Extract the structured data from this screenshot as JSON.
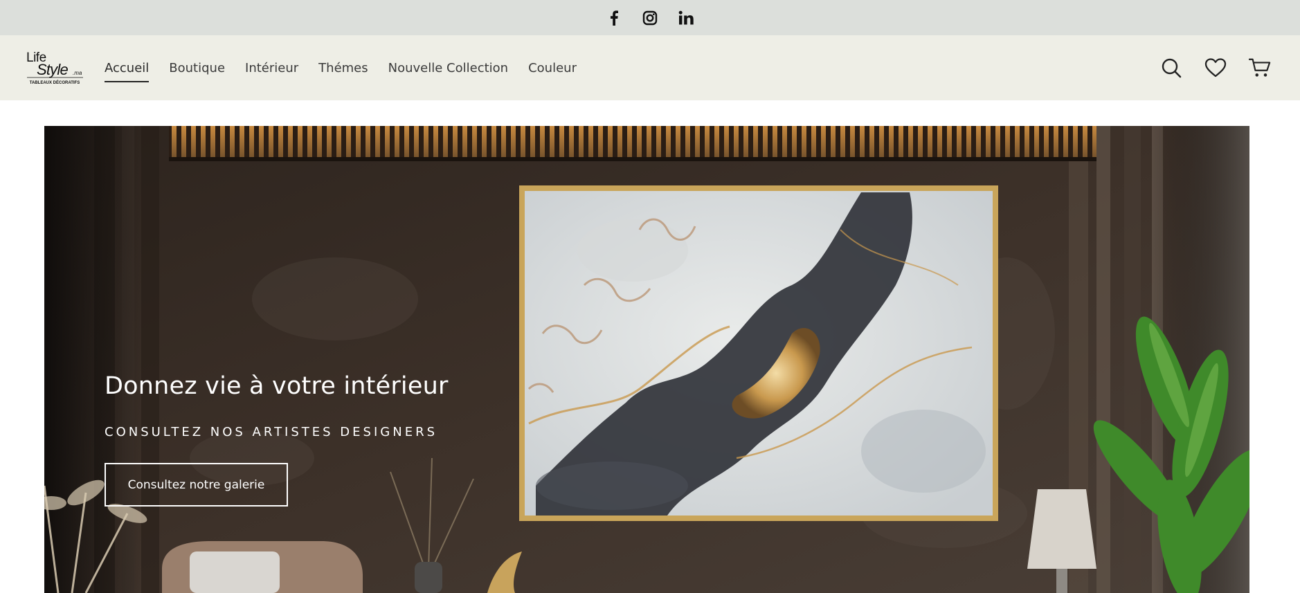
{
  "social": [
    {
      "icon": "facebook-icon"
    },
    {
      "icon": "instagram-icon"
    },
    {
      "icon": "linkedin-icon"
    }
  ],
  "logo": {
    "line1": "Life",
    "line2": "Style",
    "suffix": ".ma",
    "tagline": "TABLEAUX DÉCORATIFS"
  },
  "nav": {
    "items": [
      {
        "label": "Accueil",
        "active": true
      },
      {
        "label": "Boutique"
      },
      {
        "label": "Intérieur"
      },
      {
        "label": "Thémes"
      },
      {
        "label": "Nouvelle Collection"
      },
      {
        "label": "Couleur"
      }
    ]
  },
  "header_icons": [
    "search-icon",
    "heart-icon",
    "cart-icon"
  ],
  "hero": {
    "title": "Donnez vie à votre intérieur",
    "subtitle": "CONSULTEZ NOS ARTISTES DESIGNERS",
    "cta_label": "Consultez notre galerie"
  },
  "colors": {
    "topbar_bg": "#dcdfdb",
    "header_bg": "#eeeee6",
    "frame_gold": "#c9a55a",
    "wall_dark": "#3a2e26"
  }
}
